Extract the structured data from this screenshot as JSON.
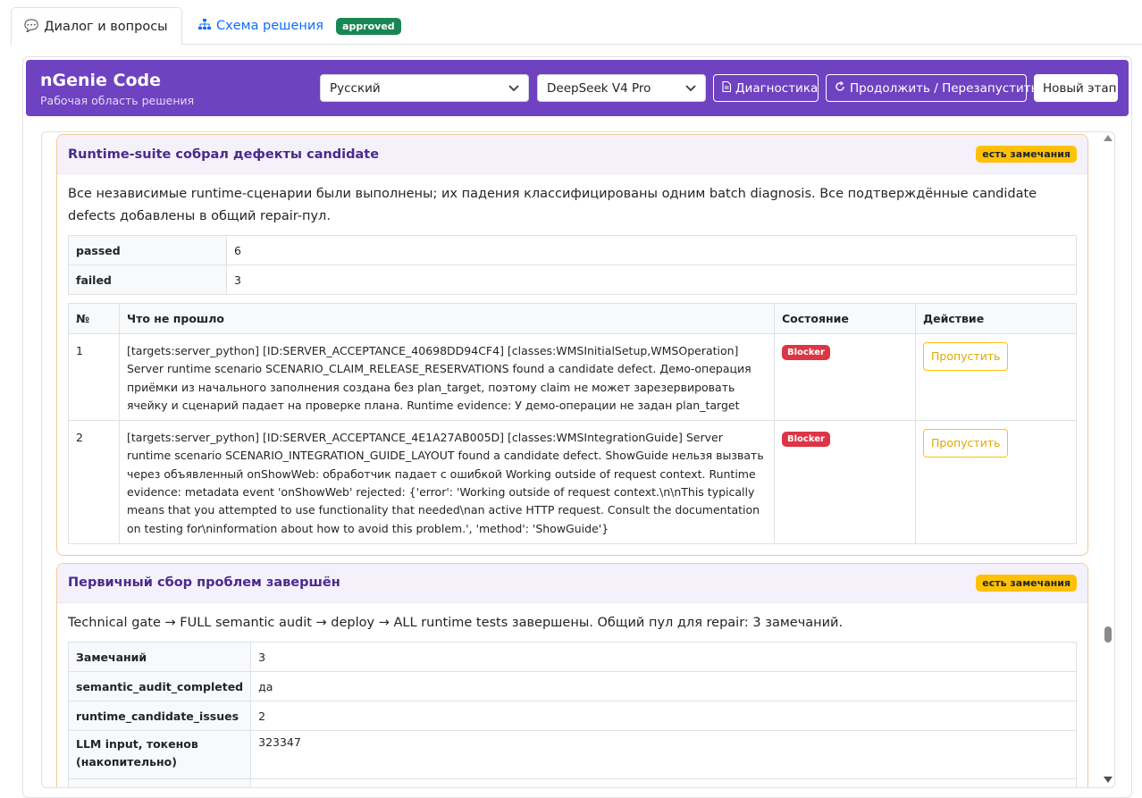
{
  "tabs": [
    {
      "label": "Диалог и вопросы",
      "icon": "chat-icon"
    },
    {
      "label": "Схема решения",
      "icon": "sitemap-icon",
      "badge": "approved"
    }
  ],
  "header": {
    "title": "nGenie Code",
    "subtitle": "Рабочая область решения",
    "language_select": "Русский",
    "model_select": "DeepSeek V4 Pro",
    "diagnostics_label": "Диагностика",
    "continue_label": "Продолжить / Перезапустить",
    "new_stage_label": "Новый этап"
  },
  "section1": {
    "title": "Runtime-suite собрал дефекты candidate",
    "badge": "есть замечания",
    "description": "Все независимые runtime-сценарии были выполнены; их падения классифицированы одним batch diagnosis. Все подтверждённые candidate defects добавлены в общий repair-пул.",
    "stats": [
      {
        "key": "passed",
        "value": "6"
      },
      {
        "key": "failed",
        "value": "3"
      }
    ],
    "columns": {
      "num": "№",
      "what": "Что не прошло",
      "state": "Состояние",
      "action": "Действие"
    },
    "rows": [
      {
        "num": "1",
        "text": "[targets:server_python] [ID:SERVER_ACCEPTANCE_40698DD94CF4] [classes:WMSInitialSetup,WMSOperation] Server runtime scenario SCENARIO_CLAIM_RELEASE_RESERVATIONS found a candidate defect. Демо-операция приёмки из начального заполнения создана без plan_target, поэтому claim не может зарезервировать ячейку и сценарий падает на проверке плана. Runtime evidence: У демо-операции не задан plan_target",
        "state": "Blocker",
        "action": "Пропустить"
      },
      {
        "num": "2",
        "text": "[targets:server_python] [ID:SERVER_ACCEPTANCE_4E1A27AB005D] [classes:WMSIntegrationGuide] Server runtime scenario SCENARIO_INTEGRATION_GUIDE_LAYOUT found a candidate defect. ShowGuide нельзя вызвать через объявленный onShowWeb: обработчик падает с ошибкой Working outside of request context. Runtime evidence: metadata event 'onShowWeb' rejected: {'error': 'Working outside of request context.\\n\\nThis typically means that you attempted to use functionality that needed\\nan active HTTP request. Consult the documentation on testing for\\ninformation about how to avoid this problem.', 'method': 'ShowGuide'}",
        "state": "Blocker",
        "action": "Пропустить"
      }
    ]
  },
  "section2": {
    "title": "Первичный сбор проблем завершён",
    "badge": "есть замечания",
    "description": "Technical gate → FULL semantic audit → deploy → ALL runtime tests завершены. Общий пул для repair: 3 замечаний.",
    "stats": [
      {
        "key": "Замечаний",
        "value": "3"
      },
      {
        "key": "semantic_audit_completed",
        "value": "да"
      },
      {
        "key": "runtime_candidate_issues",
        "value": "2"
      },
      {
        "key": "LLM input, токенов (накопительно)",
        "value": "323347"
      },
      {
        "key": "",
        "value": ""
      }
    ]
  },
  "colors": {
    "header_bg": "#6f42c1",
    "approved": "#198754",
    "warning": "#ffc107",
    "blocker": "#dc3545",
    "link": "#0d6efd"
  }
}
